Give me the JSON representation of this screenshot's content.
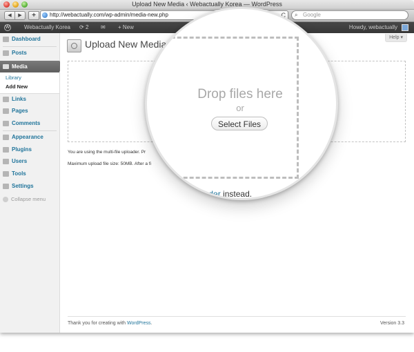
{
  "window": {
    "title": "Upload New Media ‹ Webactually Korea — WordPress"
  },
  "browser": {
    "url": "http://webactually.com/wp-admin/media-new.php",
    "search_placeholder": "Google",
    "back": "◀",
    "forward": "▶",
    "add": "+",
    "reload": "C"
  },
  "adminbar": {
    "site_name": "Webactually Korea",
    "updates": "2",
    "new_label": "New",
    "howdy": "Howdy, webactually"
  },
  "sidebar": {
    "items": [
      {
        "label": "Dashboard"
      },
      {
        "label": "Posts"
      },
      {
        "label": "Media"
      },
      {
        "label": "Links"
      },
      {
        "label": "Pages"
      },
      {
        "label": "Comments"
      },
      {
        "label": "Appearance"
      },
      {
        "label": "Plugins"
      },
      {
        "label": "Users"
      },
      {
        "label": "Tools"
      },
      {
        "label": "Settings"
      }
    ],
    "submenu": {
      "library": "Library",
      "add_new": "Add New"
    },
    "collapse_label": "Collapse menu"
  },
  "content": {
    "help_label": "Help",
    "page_title": "Upload New Media",
    "drop_text": "Drop files here",
    "or_text": "or",
    "select_files_label": "Select Files",
    "info_line_1": "You are using the multi-file uploader. Pr",
    "info_line_2": "Maximum upload file size: 50MB. After a fi",
    "inline_link": "uploader",
    "inline_suffix": " instead.",
    "footer_text": "Thank you for creating with ",
    "footer_link": "WordPress",
    "footer_period": ".",
    "version": "Version 3.3"
  }
}
